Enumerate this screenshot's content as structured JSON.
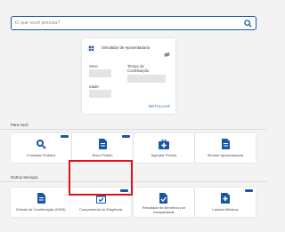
{
  "search": {
    "placeholder": "O que você precisa?"
  },
  "simulator": {
    "title": "Simulador de Aposentadoria",
    "fields": [
      "Sexo",
      "Tempo de Contribuição",
      "Idade"
    ],
    "details_link": "DETALHAR"
  },
  "sections": {
    "para_voce": {
      "title": "Para Você",
      "tiles": [
        "Consultar Pedidos",
        "Novo Pedido",
        "Agendar Perícia",
        "Simular Aposentadoria"
      ]
    },
    "outros": {
      "title": "Outros Serviços",
      "tiles": [
        "Extrato de Contribuição (CNIS)",
        "Cumprimento de Exigência",
        "Resultado de Benefício por Incapacidade",
        "Laudos Médicos"
      ]
    }
  },
  "colors": {
    "accent": "#1a56a7",
    "highlight": "#e0101a"
  },
  "icons": {
    "search": "search-icon",
    "simulator": "grid-icon",
    "visibility": "eye-off-icon",
    "consultar": "search-document-icon",
    "novo": "document-icon",
    "agendar": "medical-kit-icon",
    "simular": "document-icon",
    "extrato": "document-icon",
    "exigencia": "calendar-check-icon",
    "resultado": "document-check-icon",
    "laudos": "medical-document-icon"
  }
}
